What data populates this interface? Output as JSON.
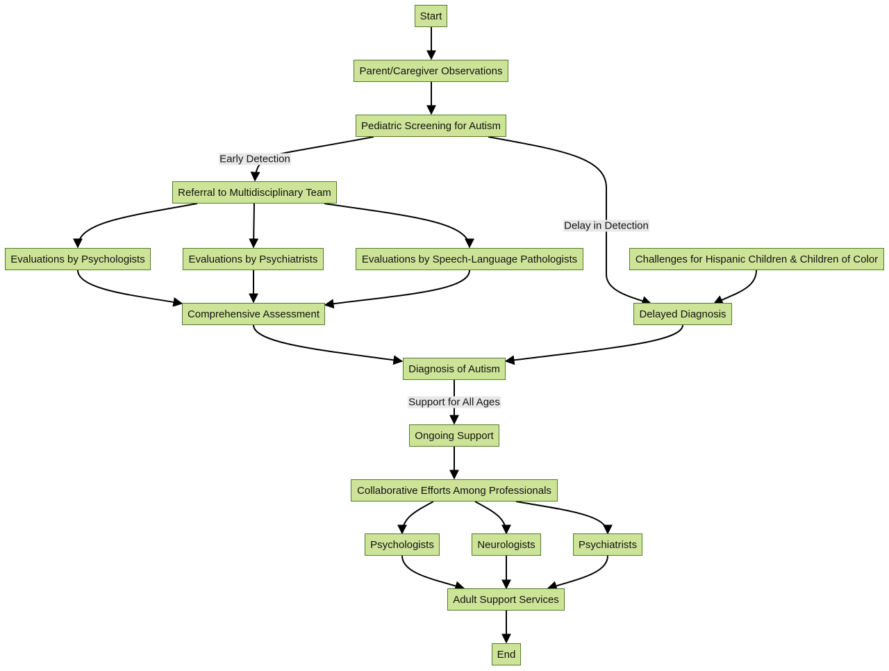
{
  "colors": {
    "node_fill": "#cde498",
    "node_border": "#4f7a28",
    "edge": "#000000",
    "edge_label_bg": "#e8e8e8"
  },
  "nodes": {
    "start": "Start",
    "observations": "Parent/Caregiver Observations",
    "screening": "Pediatric Screening for Autism",
    "referral": "Referral to Multidisciplinary Team",
    "eval_psychologists": "Evaluations by Psychologists",
    "eval_psychiatrists": "Evaluations by Psychiatrists",
    "eval_slp": "Evaluations by Speech-Language Pathologists",
    "challenges": "Challenges for Hispanic Children & Children of Color",
    "comprehensive": "Comprehensive Assessment",
    "delayed": "Delayed Diagnosis",
    "diagnosis": "Diagnosis of Autism",
    "ongoing": "Ongoing Support",
    "collaborative": "Collaborative Efforts Among Professionals",
    "psychologists": "Psychologists",
    "neurologists": "Neurologists",
    "psychiatrists": "Psychiatrists",
    "adult": "Adult Support Services",
    "end": "End"
  },
  "edge_labels": {
    "early_detection": "Early Detection",
    "delay_in_detection": "Delay in Detection",
    "support_all_ages": "Support for All Ages"
  },
  "edges": [
    {
      "from": "start",
      "to": "observations"
    },
    {
      "from": "observations",
      "to": "screening"
    },
    {
      "from": "screening",
      "to": "referral",
      "label": "early_detection"
    },
    {
      "from": "screening",
      "to": "delayed",
      "label": "delay_in_detection"
    },
    {
      "from": "referral",
      "to": "eval_psychologists"
    },
    {
      "from": "referral",
      "to": "eval_psychiatrists"
    },
    {
      "from": "referral",
      "to": "eval_slp"
    },
    {
      "from": "eval_psychologists",
      "to": "comprehensive"
    },
    {
      "from": "eval_psychiatrists",
      "to": "comprehensive"
    },
    {
      "from": "eval_slp",
      "to": "comprehensive"
    },
    {
      "from": "challenges",
      "to": "delayed"
    },
    {
      "from": "comprehensive",
      "to": "diagnosis"
    },
    {
      "from": "delayed",
      "to": "diagnosis"
    },
    {
      "from": "diagnosis",
      "to": "ongoing",
      "label": "support_all_ages"
    },
    {
      "from": "ongoing",
      "to": "collaborative"
    },
    {
      "from": "collaborative",
      "to": "psychologists"
    },
    {
      "from": "collaborative",
      "to": "neurologists"
    },
    {
      "from": "collaborative",
      "to": "psychiatrists"
    },
    {
      "from": "psychologists",
      "to": "adult"
    },
    {
      "from": "neurologists",
      "to": "adult"
    },
    {
      "from": "psychiatrists",
      "to": "adult"
    },
    {
      "from": "adult",
      "to": "end"
    }
  ]
}
